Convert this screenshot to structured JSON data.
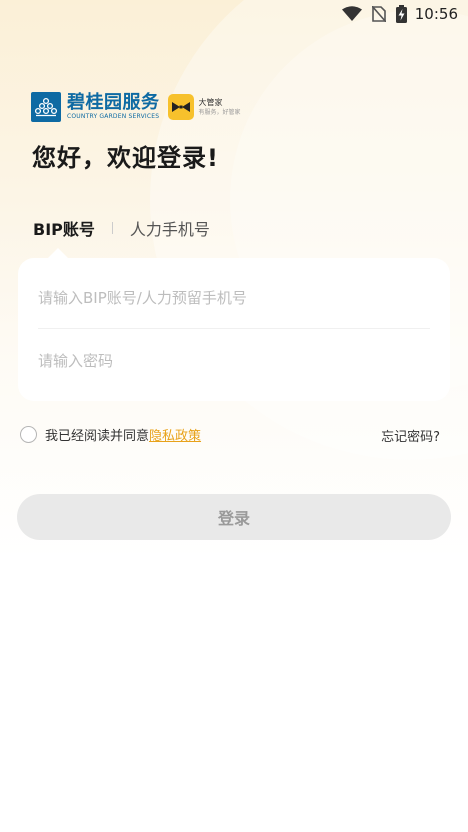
{
  "status_bar": {
    "time": "10:56",
    "icons": [
      "wifi-icon",
      "no-sim-icon",
      "battery-charging-icon"
    ]
  },
  "brand": {
    "name": "碧桂园服务",
    "subtitle": "COUNTRY GARDEN SERVICES",
    "partner_name": "大管家",
    "partner_slogan": "有服务，好管家"
  },
  "greeting": "您好，欢迎登录!",
  "tabs": [
    {
      "label": "BIP账号",
      "active": true
    },
    {
      "label": "人力手机号",
      "active": false
    }
  ],
  "form": {
    "account_placeholder": "请输入BIP账号/人力预留手机号",
    "password_placeholder": "请输入密码"
  },
  "agreement": {
    "text": "我已经阅读并同意",
    "link": "隐私政策"
  },
  "forgot_password": "忘记密码?",
  "login_button": "登录",
  "colors": {
    "brand_blue": "#0e6aa3",
    "accent_yellow": "#e8a21a",
    "button_disabled": "#e9e9e9"
  }
}
